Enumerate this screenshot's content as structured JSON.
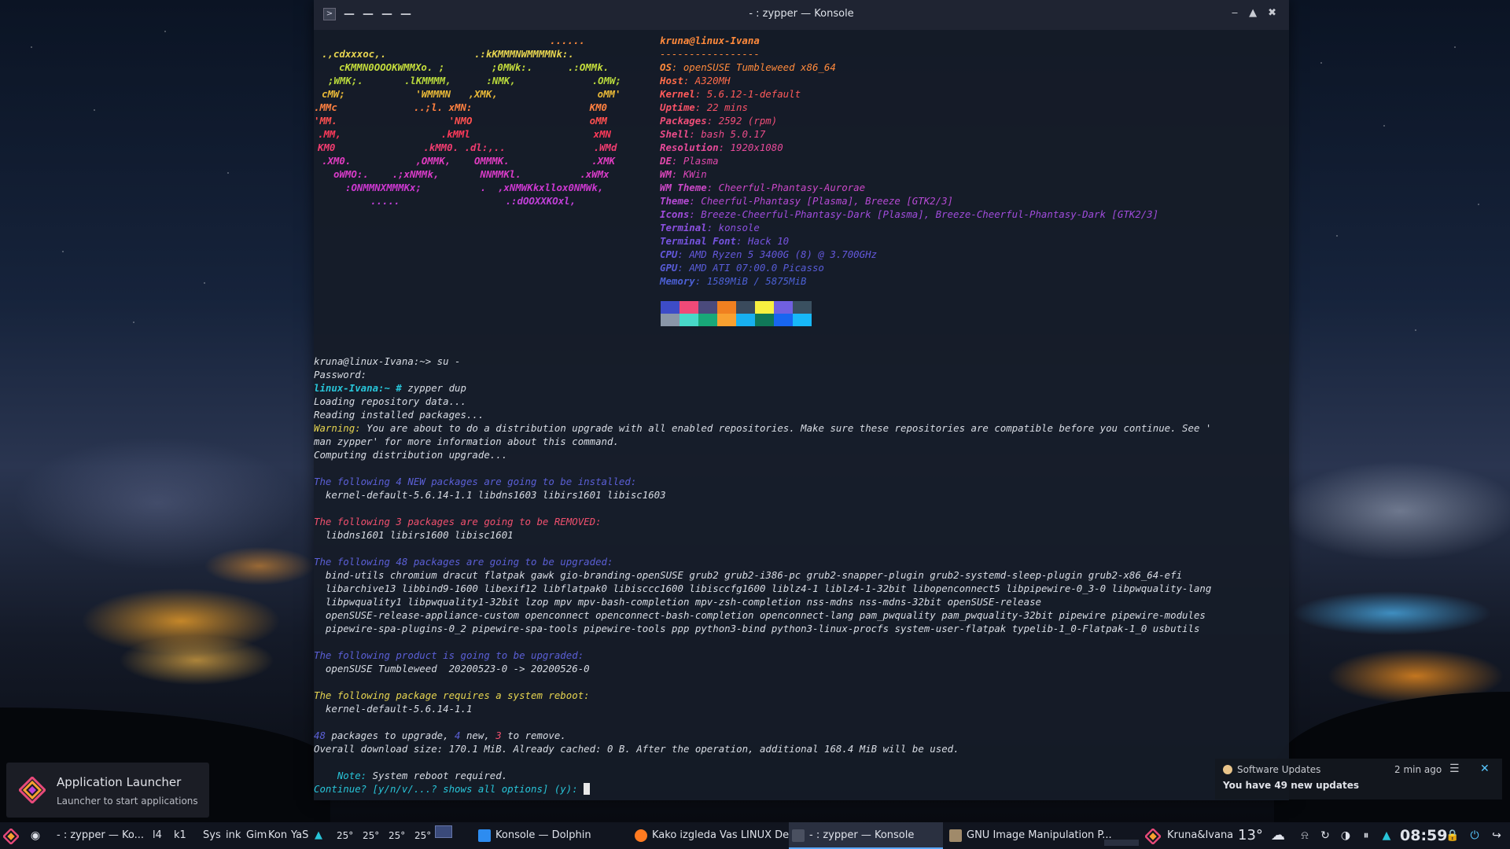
{
  "window": {
    "title": "- : zypper — Konsole"
  },
  "neofetch": {
    "logo": [
      {
        "text": "......",
        "color": "#ff8a3c"
      },
      {
        "text": ".,cdxxxoc,.               .:kKMMMNWMMMMNk:.",
        "color": "#e6d450"
      },
      {
        "text": "cKMMN0OOOKWMMXo. ;        ;0MWk:.      .:OMMk.",
        "color": "#c4dc3c"
      },
      {
        "text": ";WMK;.       .lKMMMM,      :NMK,             .OMW;",
        "color": "#b8d83c"
      },
      {
        "text": "cMW;            'WMMMN   ,XMK,                 oMM'",
        "color": "#e8b838"
      },
      {
        "text": ".MMc             ..;l. xMN:                    KM0",
        "color": "#ff8040"
      },
      {
        "text": "'MM.                   'NMO                    oMM",
        "color": "#ff5050"
      },
      {
        "text": ".MM,                 .kMMl                     xMN",
        "color": "#ff3a5a"
      },
      {
        "text": "KM0               .kMM0. .dl:,..               .WMd",
        "color": "#f03c70"
      },
      {
        "text": ".XM0.           ,OMMK,    OMMMK.              .XMK",
        "color": "#e03cc0"
      },
      {
        "text": "oWMO:.    .;xNMMk,       NNMMKl.          .xWMx",
        "color": "#d83cc8"
      },
      {
        "text": ":ONMMNXMMMKx;          .  ,xNMWKkxllox0NMWk,",
        "color": "#cc38d0"
      },
      {
        "text": ".....                  .:dOOXXKOxl,",
        "color": "#c040d8"
      }
    ],
    "user_host": "kruna@linux-Ivana",
    "separator": "-----------------",
    "info": [
      {
        "label": "OS",
        "value": "openSUSE Tumbleweed x86_64",
        "label_color": "#ff8a3c",
        "value_color": "#ff8a3c"
      },
      {
        "label": "Host",
        "value": "A320MH",
        "label_color": "#ff6c4a",
        "value_color": "#ff6c4a"
      },
      {
        "label": "Kernel",
        "value": "5.6.12-1-default",
        "label_color": "#ff5a5a",
        "value_color": "#ff5a5a"
      },
      {
        "label": "Uptime",
        "value": "22 mins",
        "label_color": "#f85268",
        "value_color": "#f85268"
      },
      {
        "label": "Packages",
        "value": "2592 (rpm)",
        "label_color": "#f04e78",
        "value_color": "#f04e78"
      },
      {
        "label": "Shell",
        "value": "bash 5.0.17",
        "label_color": "#ec4c8a",
        "value_color": "#ec4c8a"
      },
      {
        "label": "Resolution",
        "value": "1920x1080",
        "label_color": "#e84a9a",
        "value_color": "#e84a9a"
      },
      {
        "label": "DE",
        "value": "Plasma",
        "label_color": "#e048aa",
        "value_color": "#e048aa"
      },
      {
        "label": "WM",
        "value": "KWin",
        "label_color": "#d846b8",
        "value_color": "#d846b8"
      },
      {
        "label": "WM Theme",
        "value": "Cheerful-Phantasy-Aurorae",
        "label_color": "#cc48c8",
        "value_color": "#cc48c8"
      },
      {
        "label": "Theme",
        "value": "Cheerful-Phantasy [Plasma], Breeze [GTK2/3]",
        "label_color": "#b64ad4",
        "value_color": "#b64ad4"
      },
      {
        "label": "Icons",
        "value": "Breeze-Cheerful-Phantasy-Dark [Plasma], Breeze-Cheerful-Phantasy-Dark [GTK2/3]",
        "label_color": "#a04cdc",
        "value_color": "#a04cdc"
      },
      {
        "label": "Terminal",
        "value": "konsole",
        "label_color": "#8c50e0",
        "value_color": "#8c50e0"
      },
      {
        "label": "Terminal Font",
        "value": "Hack 10",
        "label_color": "#7654e0",
        "value_color": "#7654e0"
      },
      {
        "label": "CPU",
        "value": "AMD Ryzen 5 3400G (8) @ 3.700GHz",
        "label_color": "#6458dc",
        "value_color": "#6458dc"
      },
      {
        "label": "GPU",
        "value": "AMD ATI 07:00.0 Picasso",
        "label_color": "#585cd8",
        "value_color": "#585cd8"
      },
      {
        "label": "Memory",
        "value": "1589MiB / 5875MiB",
        "label_color": "#4c60d4",
        "value_color": "#4c60d4"
      }
    ],
    "palette": [
      "#3d4cc8",
      "#f04a78",
      "#4a4a7c",
      "#f08020",
      "#3a4a5c",
      "#f8f040",
      "#7060e0",
      "#3a5060",
      "#8a96a8",
      "#48d8c8",
      "#18a878",
      "#f8a030",
      "#18b0f0",
      "#107858",
      "#1866f0",
      "#18b8f8"
    ]
  },
  "terminal": {
    "lines": [
      {
        "segments": [
          {
            "t": "kruna@linux-Ivana:~> su -",
            "c": "#d8dce4"
          }
        ]
      },
      {
        "segments": [
          {
            "t": "Password:",
            "c": "#d8dce4"
          }
        ]
      },
      {
        "segments": [
          {
            "t": "linux-Ivana:~ #",
            "c": "#28c4d8",
            "b": true
          },
          {
            "t": " zypper dup",
            "c": "#d8dce4"
          }
        ]
      },
      {
        "segments": [
          {
            "t": "Loading repository data...",
            "c": "#d8dce4"
          }
        ]
      },
      {
        "segments": [
          {
            "t": "Reading installed packages...",
            "c": "#d8dce4"
          }
        ]
      },
      {
        "segments": [
          {
            "t": "Warning:",
            "c": "#e6d450"
          },
          {
            "t": " You are about to do a distribution upgrade with all enabled repositories. Make sure these repositories are compatible before you continue. See '",
            "c": "#d8dce4"
          }
        ]
      },
      {
        "segments": [
          {
            "t": "man zypper' for more information about this command.",
            "c": "#d8dce4"
          }
        ]
      },
      {
        "segments": [
          {
            "t": "Computing distribution upgrade...",
            "c": "#d8dce4"
          }
        ]
      },
      {
        "segments": [
          {
            "t": "",
            "c": "#d8dce4"
          }
        ]
      },
      {
        "segments": [
          {
            "t": "The following 4 NEW packages are going to be installed:",
            "c": "#5b5fd6"
          }
        ]
      },
      {
        "segments": [
          {
            "t": "  kernel-default-5.6.14-1.1 libdns1603 libirs1601 libisc1603",
            "c": "#d8dce4"
          }
        ]
      },
      {
        "segments": [
          {
            "t": "",
            "c": "#d8dce4"
          }
        ]
      },
      {
        "segments": [
          {
            "t": "The following 3 packages are going to be REMOVED:",
            "c": "#f0506e"
          }
        ]
      },
      {
        "segments": [
          {
            "t": "  libdns1601 libirs1600 libisc1601",
            "c": "#d8dce4"
          }
        ]
      },
      {
        "segments": [
          {
            "t": "",
            "c": "#d8dce4"
          }
        ]
      },
      {
        "segments": [
          {
            "t": "The following 48 packages are going to be upgraded:",
            "c": "#5b5fd6"
          }
        ]
      },
      {
        "segments": [
          {
            "t": "  bind-utils chromium dracut flatpak gawk gio-branding-openSUSE grub2 grub2-i386-pc grub2-snapper-plugin grub2-systemd-sleep-plugin grub2-x86_64-efi",
            "c": "#d8dce4"
          }
        ]
      },
      {
        "segments": [
          {
            "t": "  libarchive13 libbind9-1600 libexif12 libflatpak0 libisccc1600 libisccfg1600 liblz4-1 liblz4-1-32bit libopenconnect5 libpipewire-0_3-0 libpwquality-lang",
            "c": "#d8dce4"
          }
        ]
      },
      {
        "segments": [
          {
            "t": "  libpwquality1 libpwquality1-32bit lzop mpv mpv-bash-completion mpv-zsh-completion nss-mdns nss-mdns-32bit openSUSE-release",
            "c": "#d8dce4"
          }
        ]
      },
      {
        "segments": [
          {
            "t": "  openSUSE-release-appliance-custom openconnect openconnect-bash-completion openconnect-lang pam_pwquality pam_pwquality-32bit pipewire pipewire-modules",
            "c": "#d8dce4"
          }
        ]
      },
      {
        "segments": [
          {
            "t": "  pipewire-spa-plugins-0_2 pipewire-spa-tools pipewire-tools ppp python3-bind python3-linux-procfs system-user-flatpak typelib-1_0-Flatpak-1_0 usbutils",
            "c": "#d8dce4"
          }
        ]
      },
      {
        "segments": [
          {
            "t": "",
            "c": "#d8dce4"
          }
        ]
      },
      {
        "segments": [
          {
            "t": "The following product is going to be upgraded:",
            "c": "#5b5fd6"
          }
        ]
      },
      {
        "segments": [
          {
            "t": "  openSUSE Tumbleweed  20200523-0 -> 20200526-0",
            "c": "#d8dce4"
          }
        ]
      },
      {
        "segments": [
          {
            "t": "",
            "c": "#d8dce4"
          }
        ]
      },
      {
        "segments": [
          {
            "t": "The following package requires a system reboot:",
            "c": "#e6d450"
          }
        ]
      },
      {
        "segments": [
          {
            "t": "  kernel-default-5.6.14-1.1",
            "c": "#d8dce4"
          }
        ]
      },
      {
        "segments": [
          {
            "t": "",
            "c": "#d8dce4"
          }
        ]
      },
      {
        "segments": [
          {
            "t": "48",
            "c": "#5b5fd6"
          },
          {
            "t": " packages to upgrade, ",
            "c": "#d8dce4"
          },
          {
            "t": "4",
            "c": "#5b5fd6"
          },
          {
            "t": " new, ",
            "c": "#d8dce4"
          },
          {
            "t": "3",
            "c": "#f0506e"
          },
          {
            "t": " to remove.",
            "c": "#d8dce4"
          }
        ]
      },
      {
        "segments": [
          {
            "t": "Overall download size: 170.1 MiB. Already cached: 0 B. After the operation, additional 168.4 MiB will be used.",
            "c": "#d8dce4"
          }
        ]
      },
      {
        "segments": [
          {
            "t": "",
            "c": "#d8dce4"
          }
        ]
      },
      {
        "segments": [
          {
            "t": "    Note:",
            "c": "#28c4d8"
          },
          {
            "t": " System reboot required.",
            "c": "#d8dce4"
          }
        ]
      },
      {
        "segments": [
          {
            "t": "Continue? [y/n/v/...? shows all options] (y): ",
            "c": "#28c4d8"
          }
        ]
      }
    ]
  },
  "launcher_tooltip": {
    "title": "Application Launcher",
    "subtitle": "Launcher to start applications"
  },
  "notification": {
    "title": "Software Updates",
    "time": "2 min ago",
    "body": "You have 49 new updates"
  },
  "taskbar": {
    "current_task": "- : zypper — Ko...",
    "desktop_labels": [
      "l4",
      "k1"
    ],
    "quick_launch": [
      "Sys",
      "ink",
      "Gim",
      "Kon",
      "YaS"
    ],
    "temps": [
      "25°",
      "25°",
      "25°",
      "25°"
    ],
    "tasks": [
      {
        "label": "Konsole — Dolphin",
        "icon_color": "#2d8cf0",
        "active": false
      },
      {
        "label": "Kako izgleda Vas LINUX De...",
        "icon_color": "#ff7a20",
        "active": false
      },
      {
        "label": "- : zypper — Konsole",
        "icon_color": "#4a5060",
        "active": true
      },
      {
        "label": "GNU Image Manipulation P...",
        "icon_color": "#a08a6a",
        "active": false
      }
    ],
    "user": "Kruna&Ivana",
    "weather_temp": "13°",
    "clock": "08:59"
  }
}
